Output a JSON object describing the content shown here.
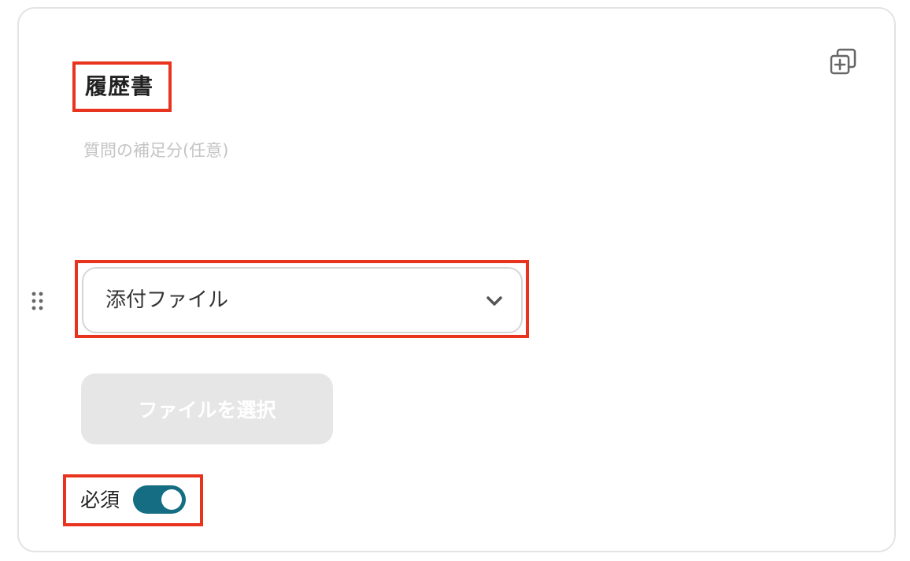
{
  "card": {
    "title": "履歴書",
    "description_placeholder": "質問の補足分(任意)",
    "copy_icon": "copy-plus-icon",
    "drag_icon": "drag-handle-icon"
  },
  "field_type": {
    "selected": "添付ファイル",
    "chevron_icon": "chevron-down-icon"
  },
  "file_button": {
    "label": "ファイルを選択",
    "enabled": false
  },
  "required": {
    "label": "必須",
    "on": true
  },
  "colors": {
    "toggle_on": "#156d84",
    "highlight_border": "#e8331e",
    "disabled_button": "#e6e6e6"
  }
}
